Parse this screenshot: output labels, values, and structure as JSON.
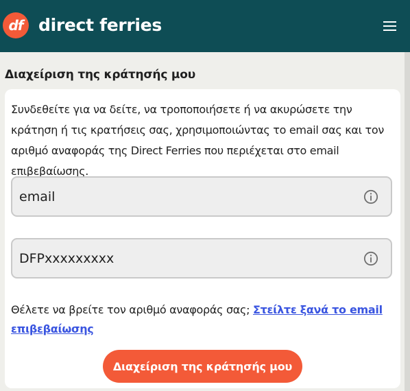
{
  "header": {
    "logo_text": "df",
    "brand_name": "direct ferries",
    "menu_icon": "hamburger-menu-icon",
    "bg_color": "#0e4d55",
    "accent_color": "#f35a38"
  },
  "manage": {
    "title": "Διαχείριση της κράτησής μου",
    "intro": "Συνδεθείτε για να δείτε, να τροποποιήσετε ή να ακυρώσετε την κράτηση ή τις κρατήσεις σας, χρησιμοποιώντας το email σας και τον αριθμό αναφοράς της Direct Ferries που περιέχεται στο email επιβεβαίωσης.",
    "email_field": {
      "placeholder": "email",
      "icon": "info-icon"
    },
    "reference_field": {
      "placeholder": "DFPxxxxxxxxx",
      "icon": "info-icon"
    },
    "helper_text": "Θέλετε να βρείτε τον αριθμό αναφοράς σας; ",
    "resend_link": "Στείλτε ξανά το email επιβεβαίωσης",
    "submit_label": "Διαχείριση της κράτησής μου"
  }
}
